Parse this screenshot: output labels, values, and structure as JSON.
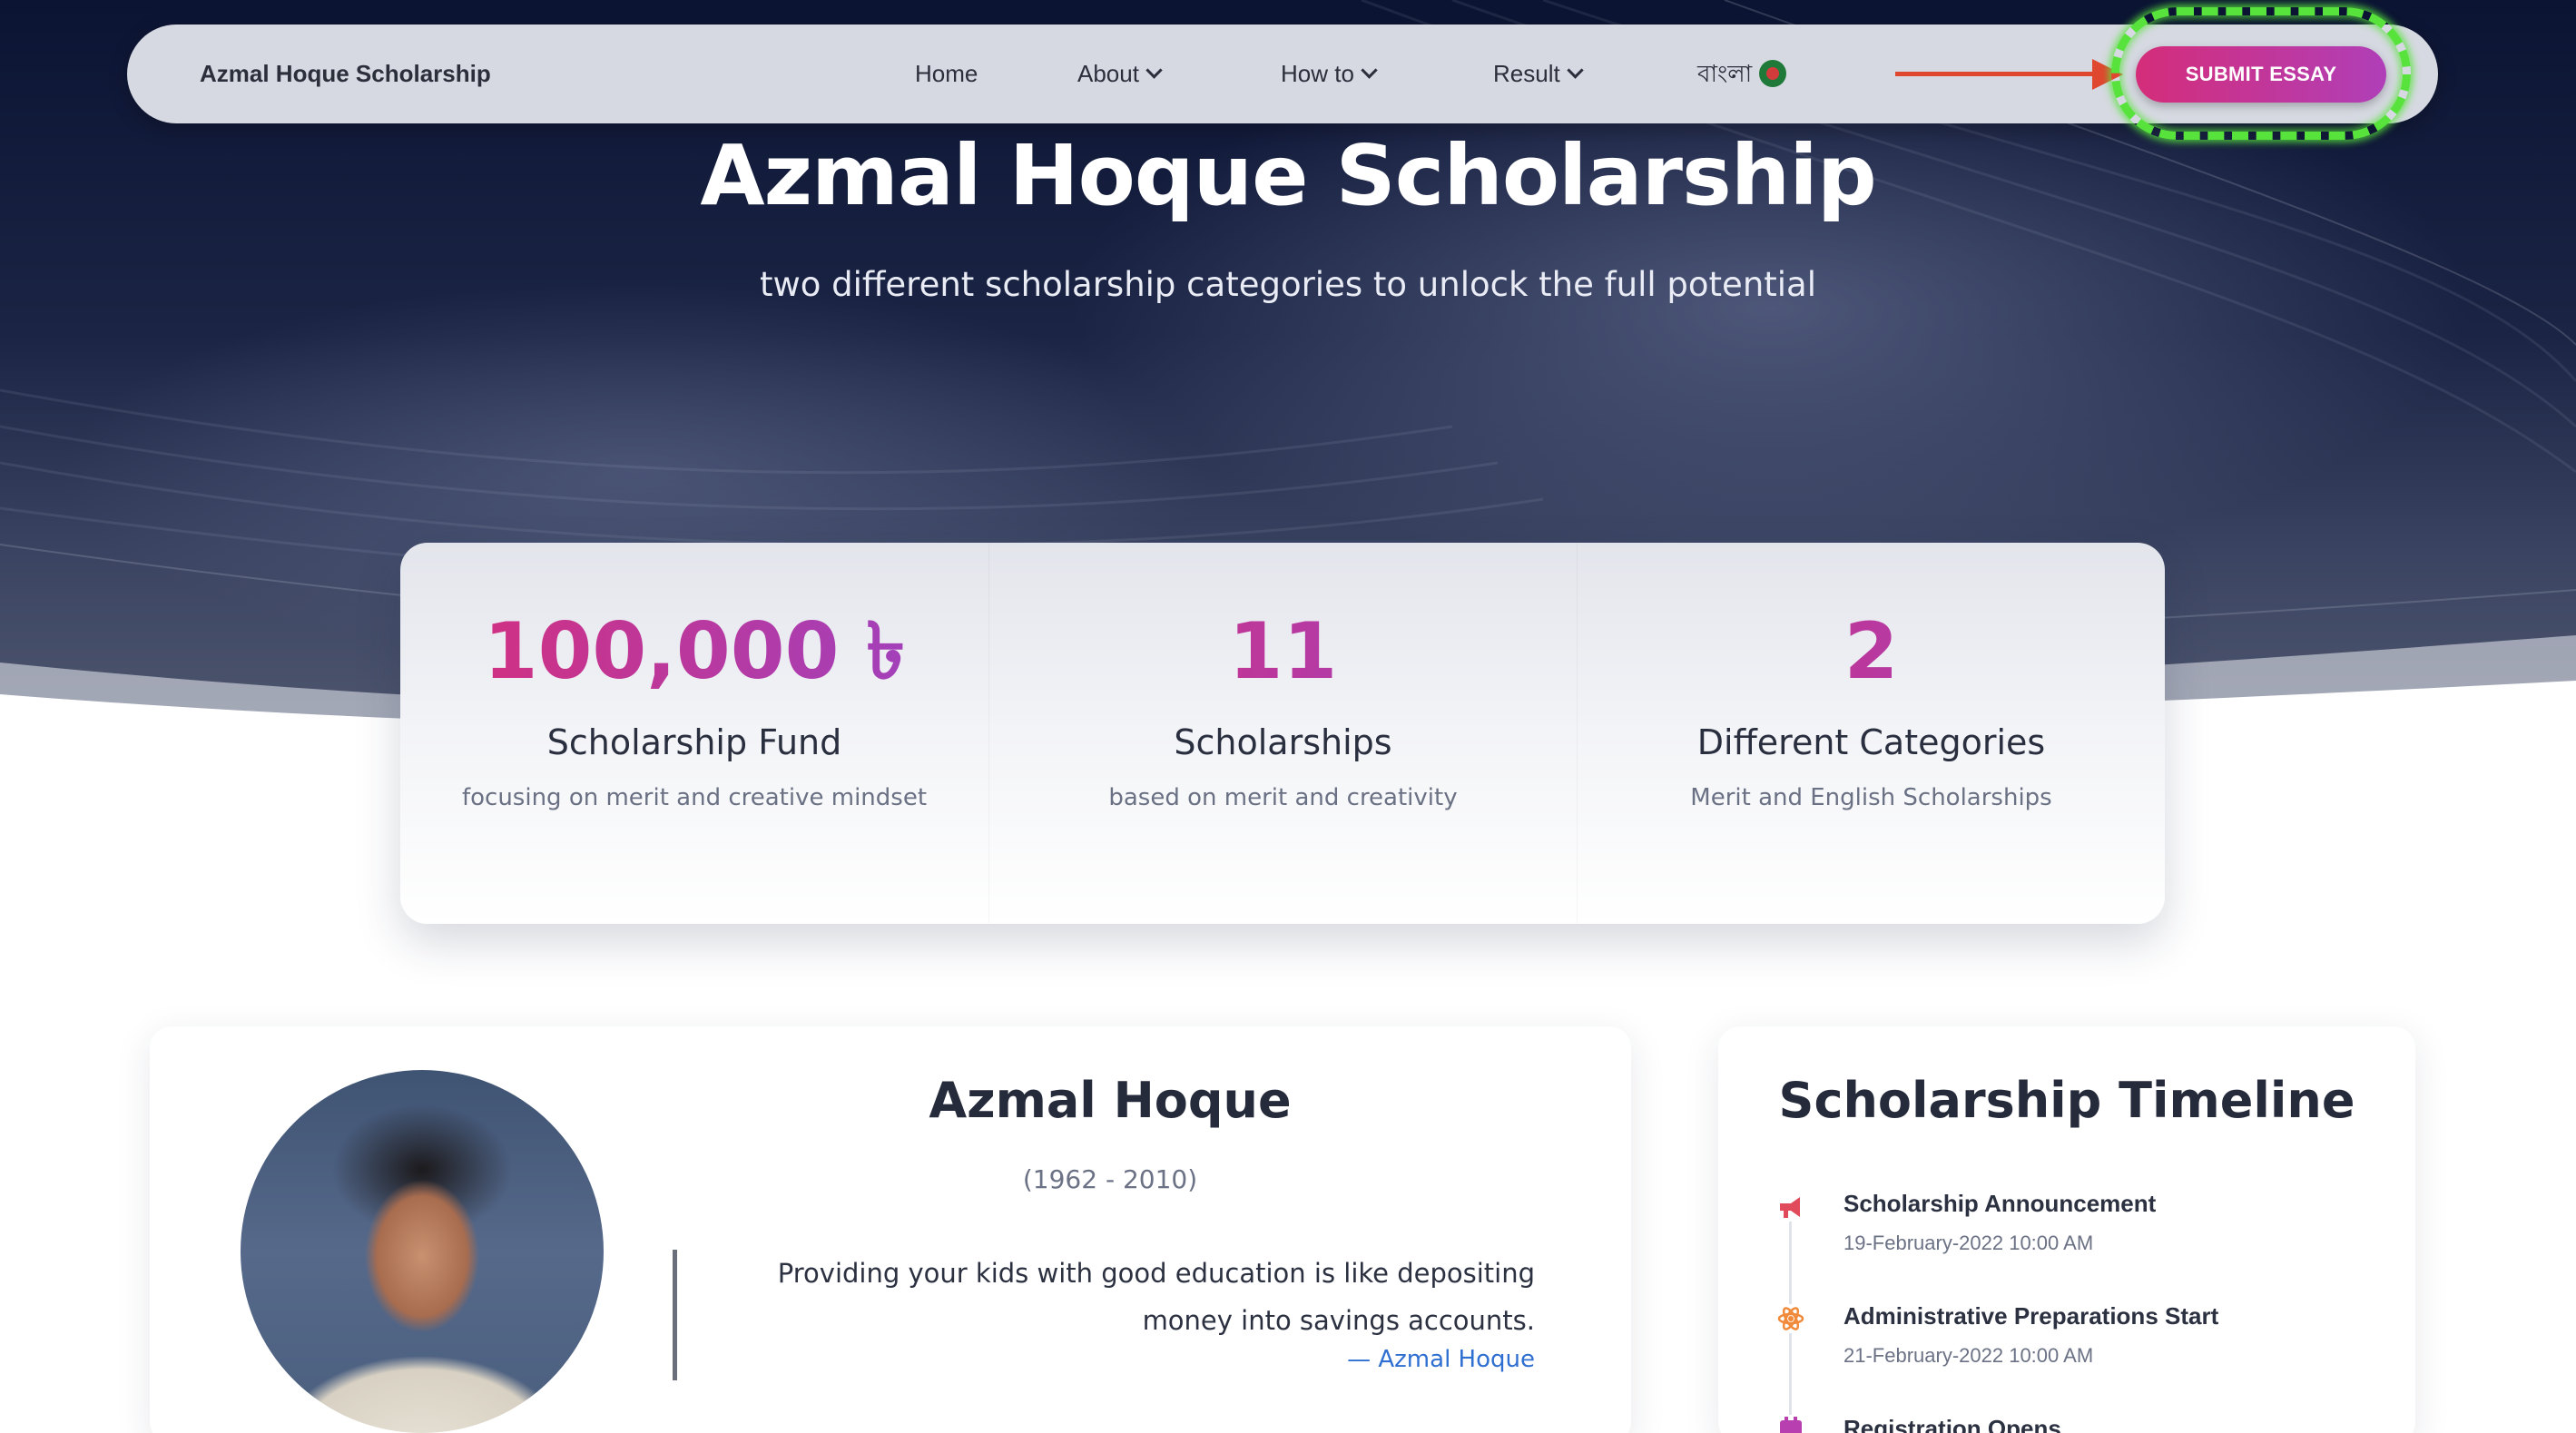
{
  "navbar": {
    "brand": "Azmal Hoque Scholarship",
    "items": [
      {
        "label": "Home",
        "has_dropdown": false
      },
      {
        "label": "About",
        "has_dropdown": true
      },
      {
        "label": "How to",
        "has_dropdown": true
      },
      {
        "label": "Result",
        "has_dropdown": true
      }
    ],
    "language": "বাংলা",
    "language_icon": "bangladesh-flag-icon",
    "cta_label": "SUBMIT ESSAY"
  },
  "hero": {
    "title": "Azmal Hoque Scholarship",
    "subtitle": "two different scholarship categories to unlock the full potential"
  },
  "stats": [
    {
      "value": "100,000 ৳",
      "title": "Scholarship Fund",
      "description": "focusing on merit and creative mindset"
    },
    {
      "value": "11",
      "title": "Scholarships",
      "description": "based on merit and creativity"
    },
    {
      "value": "2",
      "title": "Different Categories",
      "description": "Merit and English Scholarships"
    }
  ],
  "person": {
    "name": "Azmal Hoque",
    "years": "(1962 - 2010)",
    "quote": "Providing your kids with good education is like depositing money into savings accounts.",
    "quote_author": "— Azmal Hoque"
  },
  "timeline": {
    "title": "Scholarship Timeline",
    "items": [
      {
        "title": "Scholarship Announcement",
        "date": "19-February-2022 10:00 AM",
        "icon": "megaphone-icon"
      },
      {
        "title": "Administrative Preparations Start",
        "date": "21-February-2022 10:00 AM",
        "icon": "atom-icon"
      },
      {
        "title": "Registration Opens",
        "date": "",
        "icon": "calendar-icon"
      }
    ]
  },
  "colors": {
    "accent_start": "#d42d7a",
    "accent_end": "#b03fb8",
    "annotation_arrow": "#e0472f",
    "annotation_ring": "#58e33c",
    "hero_dark": "#0b1433"
  }
}
